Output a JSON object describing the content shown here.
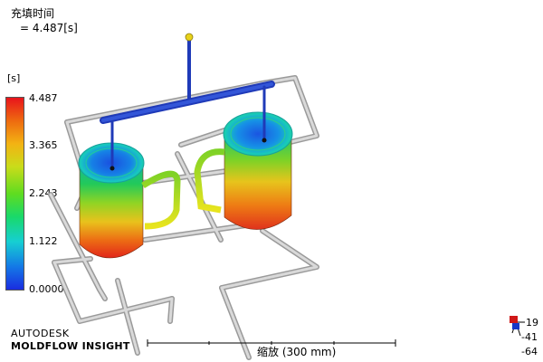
{
  "result": {
    "title": "充填时间",
    "value_text": "= 4.487[s]"
  },
  "legend": {
    "unit": "[s]",
    "ticks": [
      "4.487",
      "3.365",
      "2.243",
      "1.122",
      "0.0000"
    ],
    "gradient_colors": [
      "#e8141c",
      "#ee6a10",
      "#f3b313",
      "#c9dc1a",
      "#5fdc20",
      "#19d96a",
      "#16cfd2",
      "#1479e6",
      "#1a2ce0"
    ]
  },
  "branding": {
    "line1": "AUTODESK",
    "line2": "MOLDFLOW INSIGHT"
  },
  "scale_bar": {
    "label": "缩放 (300 mm)"
  },
  "axis_triad": {
    "labels": [
      "19",
      "-41",
      "-64"
    ]
  },
  "colors": {
    "pipe": "#c8c8c8",
    "runner": "#1f3ab8",
    "gate_marker": "#e8d21a",
    "hot": "#e82a18",
    "cold": "#1a4fe0"
  }
}
